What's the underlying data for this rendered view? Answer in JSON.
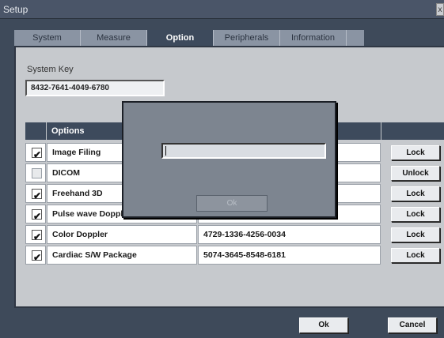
{
  "window": {
    "title": "Setup",
    "close_label": "x"
  },
  "tabs": [
    {
      "label": "System"
    },
    {
      "label": "Measure"
    },
    {
      "label": "Option"
    },
    {
      "label": "Peripherals"
    },
    {
      "label": "Information"
    }
  ],
  "active_tab": "Option",
  "system_key": {
    "label": "System Key",
    "value": "8432-7641-4049-6780"
  },
  "options_table": {
    "header": "Options",
    "rows": [
      {
        "checked": true,
        "name": "Image Filing",
        "key": "",
        "button": "Lock"
      },
      {
        "checked": false,
        "name": "DICOM",
        "key": "",
        "button": "Unlock"
      },
      {
        "checked": true,
        "name": "Freehand 3D",
        "key": "",
        "button": "Lock"
      },
      {
        "checked": true,
        "name": "Pulse wave Dopple",
        "key": "",
        "button": "Lock"
      },
      {
        "checked": true,
        "name": "Color Doppler",
        "key": "4729-1336-4256-0034",
        "button": "Lock"
      },
      {
        "checked": true,
        "name": "Cardiac S/W Package",
        "key": "5074-3645-8548-6181",
        "button": "Lock"
      }
    ]
  },
  "dialog": {
    "input_value": "",
    "ok_label": "Ok"
  },
  "footer": {
    "ok_label": "Ok",
    "cancel_label": "Cancel"
  }
}
